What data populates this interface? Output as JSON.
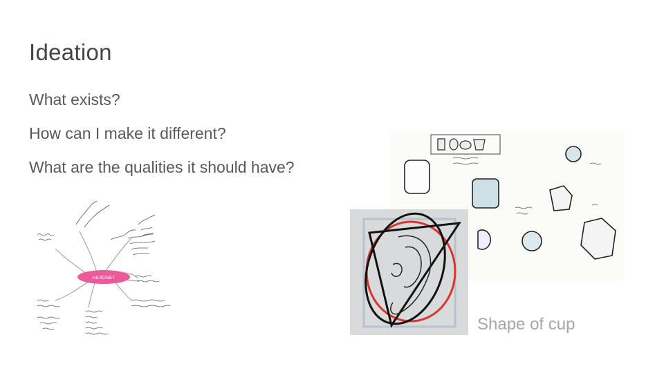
{
  "slide": {
    "title": "Ideation",
    "bullets": [
      "What exists?",
      "How can I make it different?",
      "What are the qualities it should have?"
    ],
    "caption": "Shape of cup"
  },
  "mindmap": {
    "center_label": "HEADSET"
  },
  "colors": {
    "title": "#444444",
    "bullet": "#595959",
    "caption": "#a6a6a6",
    "mindmap_center": "#ec5a9a",
    "ear_red": "#d8352b"
  }
}
